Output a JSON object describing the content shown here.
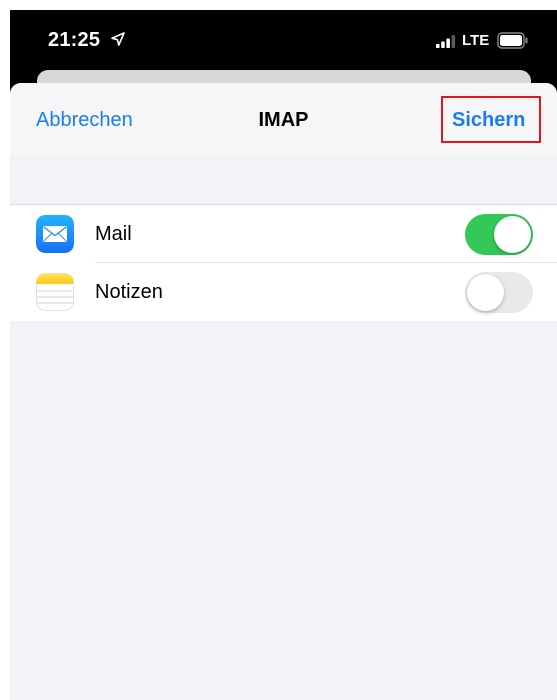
{
  "status_bar": {
    "time": "21:25",
    "network": "LTE",
    "location_icon": "location-arrow-icon",
    "signal_icon": "cellular-signal-icon",
    "battery_icon": "battery-icon"
  },
  "nav": {
    "cancel_label": "Abbrechen",
    "title": "IMAP",
    "save_label": "Sichern"
  },
  "settings": {
    "items": [
      {
        "label": "Mail",
        "icon": "mail-app-icon",
        "enabled": true
      },
      {
        "label": "Notizen",
        "icon": "notes-app-icon",
        "enabled": false
      }
    ]
  },
  "colors": {
    "accent": "#1a7cf5",
    "toggle_on": "#34c759",
    "toggle_off": "#e9e9ea",
    "highlight": "#e0161e",
    "background": "#f2f2f7"
  }
}
